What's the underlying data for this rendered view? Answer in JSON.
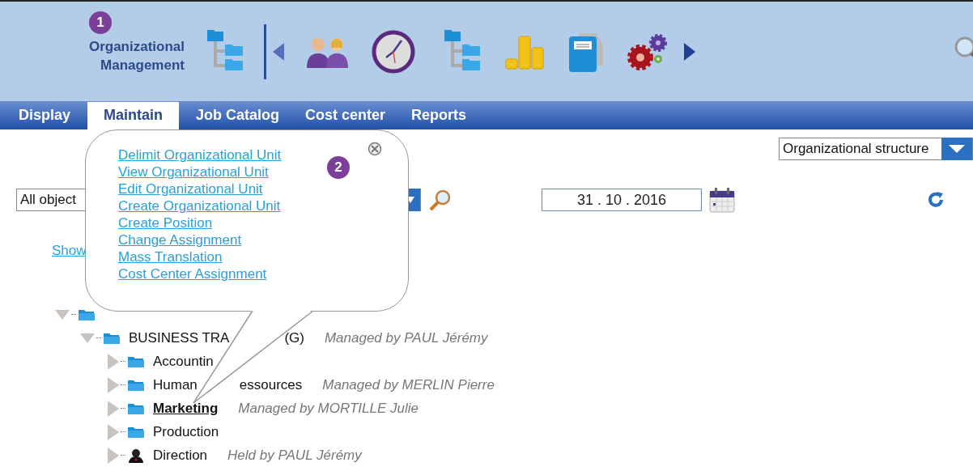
{
  "header": {
    "title": "Organizational Management"
  },
  "badges": [
    {
      "label": "1"
    },
    {
      "label": "2"
    }
  ],
  "tabs": [
    {
      "label": "Display",
      "selected": false
    },
    {
      "label": "Maintain",
      "selected": true
    },
    {
      "label": "Job Catalog",
      "selected": false
    },
    {
      "label": "Cost center",
      "selected": false
    },
    {
      "label": "Reports",
      "selected": false
    }
  ],
  "structure_select": {
    "value": "Organizational structure"
  },
  "filter_select": {
    "value": "All object"
  },
  "date_field": {
    "value": "31 . 10 . 2016"
  },
  "show_link": "Show",
  "popover": {
    "links": [
      "Delimit Organizational Unit",
      "View Organizational Unit",
      "Edit Organizational Unit",
      "Create Organizational Unit",
      "Create Position",
      "Change Assignment",
      "Mass Translation",
      "Cost Center Assignment"
    ]
  },
  "tree": [
    {
      "kind": "folder",
      "expanded": true,
      "children": [
        {
          "kind": "folder",
          "expanded": true,
          "selected": false,
          "label": "BUSINESS TRA",
          "label_after": "(G)",
          "note": "Managed by PAUL Jérémy",
          "children": [
            {
              "kind": "folder",
              "expanded": false,
              "selected": false,
              "label": "Accountin"
            },
            {
              "kind": "folder",
              "expanded": false,
              "selected": false,
              "label": "Human",
              "label_after": "essources",
              "note": "Managed by MERLIN Pierre"
            },
            {
              "kind": "folder",
              "expanded": false,
              "selected": true,
              "label": "Marketing",
              "note": "Managed by MORTILLE Julie"
            },
            {
              "kind": "folder",
              "expanded": false,
              "selected": false,
              "label": "Production"
            },
            {
              "kind": "person",
              "expanded": false,
              "selected": false,
              "label": "Direction",
              "note": "Held by PAUL Jérémy"
            }
          ]
        }
      ]
    }
  ]
}
